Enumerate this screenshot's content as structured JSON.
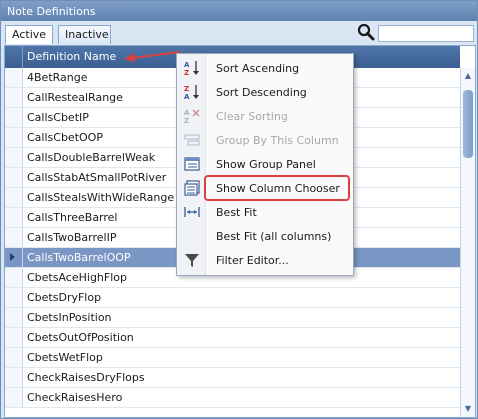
{
  "window": {
    "title": "Note Definitions"
  },
  "tabs": [
    {
      "label": "Active"
    },
    {
      "label": "Inactive"
    }
  ],
  "search": {
    "value": ""
  },
  "grid": {
    "column_header": "Definition Name",
    "rows": [
      "4BetRange",
      "CallRestealRange",
      "CallsCbetIP",
      "CallsCbetOOP",
      "CallsDoubleBarrelWeak",
      "CallsStabAtSmallPotRiver",
      "CallsStealsWithWideRange",
      "CallsThreeBarrel",
      "CallsTwoBarrelIP",
      "CallsTwoBarrelOOP",
      "CbetsAceHighFlop",
      "CbetsDryFlop",
      "CbetsInPosition",
      "CbetsOutOfPosition",
      "CbetsWetFlop",
      "CheckRaisesDryFlops",
      "CheckRaisesHero"
    ],
    "selected_row": "CallsTwoBarrelOOP"
  },
  "context_menu": {
    "items": [
      {
        "label": "Sort Ascending",
        "icon": "sort-ascending-icon",
        "enabled": true
      },
      {
        "label": "Sort Descending",
        "icon": "sort-descending-icon",
        "enabled": true
      },
      {
        "label": "Clear Sorting",
        "icon": "clear-sorting-icon",
        "enabled": false
      },
      {
        "label": "Group By This Column",
        "icon": "group-by-column-icon",
        "enabled": false
      },
      {
        "label": "Show Group Panel",
        "icon": "group-panel-icon",
        "enabled": true
      },
      {
        "label": "Show Column Chooser",
        "icon": "column-chooser-icon",
        "enabled": true
      },
      {
        "label": "Best Fit",
        "icon": "best-fit-icon",
        "enabled": true
      },
      {
        "label": "Best Fit (all columns)",
        "icon": "",
        "enabled": true
      },
      {
        "label": "Filter Editor...",
        "icon": "filter-icon",
        "enabled": true
      }
    ],
    "highlighted": "Show Column Chooser"
  },
  "colors": {
    "header": "#3b5f93",
    "selection": "#7a96c4",
    "highlight_box": "#d9423c",
    "annotation_arrow": "#d9423c"
  }
}
